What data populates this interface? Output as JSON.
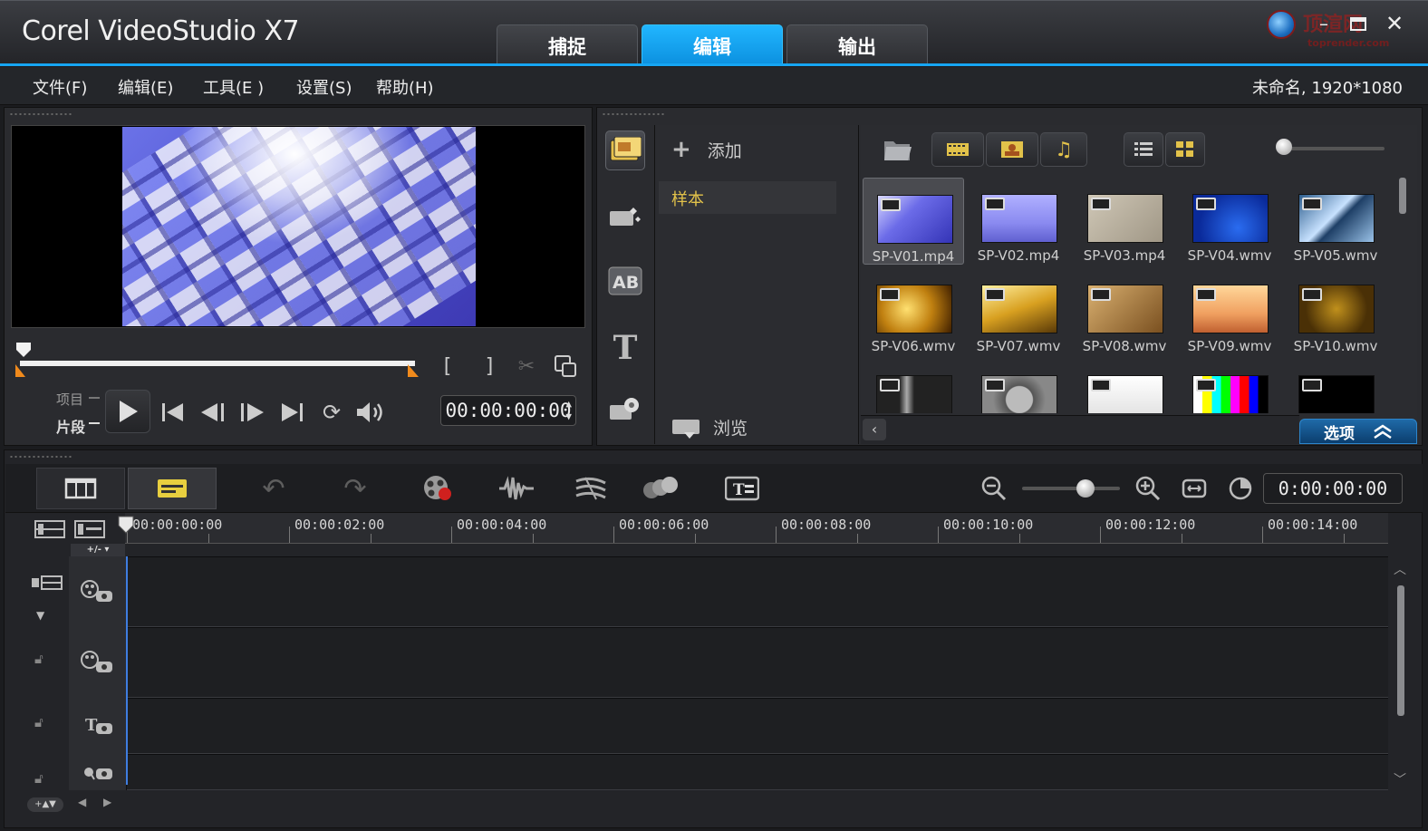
{
  "app": {
    "title": "Corel VideoStudio X7",
    "project_info": "未命名, 1920*1080"
  },
  "tabs": [
    {
      "label": "捕捉"
    },
    {
      "label": "编辑"
    },
    {
      "label": "输出"
    }
  ],
  "watermark": {
    "site": "顶渲网",
    "url": "toprender.com"
  },
  "menu": {
    "file": "文件(F)",
    "edit": "编辑(E)",
    "tools": "工具(E )",
    "settings": "设置(S)",
    "help": "帮助(H)"
  },
  "player": {
    "mode_project": "项目",
    "mode_clip": "片段",
    "timecode": "00:00:00:00",
    "mark_in": "[",
    "mark_out": "]"
  },
  "library": {
    "add_label": "添加",
    "folder_sample": "样本",
    "browse_label": "浏览",
    "options_label": "选项"
  },
  "clips": [
    {
      "name": "SP-V01.mp4",
      "selected": true
    },
    {
      "name": "SP-V02.mp4"
    },
    {
      "name": "SP-V03.mp4"
    },
    {
      "name": "SP-V04.wmv"
    },
    {
      "name": "SP-V05.wmv"
    },
    {
      "name": "SP-V06.wmv"
    },
    {
      "name": "SP-V07.wmv"
    },
    {
      "name": "SP-V08.wmv"
    },
    {
      "name": "SP-V09.wmv"
    },
    {
      "name": "SP-V10.wmv"
    },
    {
      "name": ""
    },
    {
      "name": ""
    },
    {
      "name": ""
    },
    {
      "name": ""
    },
    {
      "name": ""
    }
  ],
  "timeline": {
    "timecode": "0:00:00:00",
    "ruler": [
      "00:00:00:00",
      "00:00:02:00",
      "00:00:04:00",
      "00:00:06:00",
      "00:00:08:00",
      "00:00:10:00",
      "00:00:12:00",
      "00:00:14:00"
    ],
    "add_remove": "+/- ▾"
  },
  "colors": {
    "accent": "#16a5f2",
    "highlight": "#e2c24a",
    "playhead": "#3f7de0"
  }
}
